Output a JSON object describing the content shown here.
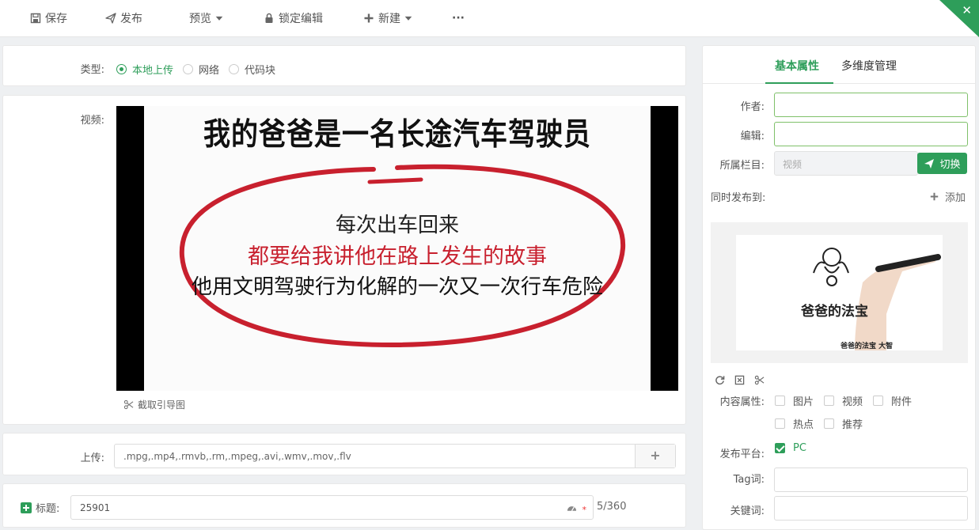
{
  "toolbar": {
    "save": "保存",
    "publish": "发布",
    "preview": "预览",
    "lock_edit": "锁定编辑",
    "new": "新建",
    "more": "···",
    "close": "✕"
  },
  "type_row": {
    "label": "类型:",
    "options": [
      "本地上传",
      "网络",
      "代码块"
    ],
    "selected": "本地上传"
  },
  "video_row": {
    "label": "视频:",
    "frame_text": {
      "headline": "我的爸爸是一名长途汽车驾驶员",
      "line1": "每次出车回来",
      "line2": "都要给我讲他在路上发生的故事",
      "line3": "他用文明驾驶行为化解的一次又一次行车危险"
    },
    "capture": "截取引导图"
  },
  "upload_row": {
    "label": "上传:",
    "formats": ".mpg,.mp4,.rmvb,.rm,.mpeg,.avi,.wmv,.mov,.flv",
    "add": "+"
  },
  "title_row": {
    "label": "标题:",
    "value": "25901",
    "required": "*",
    "count": "5/360"
  },
  "right_panel": {
    "tabs": [
      "基本属性",
      "多维度管理"
    ],
    "author_label": "作者:",
    "author_value": "",
    "editor_label": "编辑:",
    "editor_value": "",
    "column_label": "所属栏目:",
    "column_value": "视频",
    "switch": "切换",
    "copublish_label": "同时发布到:",
    "add": "添加",
    "thumb_text": {
      "caption": "爸爸的法宝",
      "sub": "爸爸的法宝    大智"
    },
    "content_label": "内容属性:",
    "content_options": [
      "图片",
      "视频",
      "附件",
      "热点",
      "推荐"
    ],
    "platform_label": "发布平台:",
    "platform_value": "PC",
    "tag_label": "Tag词:",
    "keyword_label": "关键词:"
  },
  "colors": {
    "accent": "#2e9e5a",
    "red_text": "#c8202e"
  }
}
